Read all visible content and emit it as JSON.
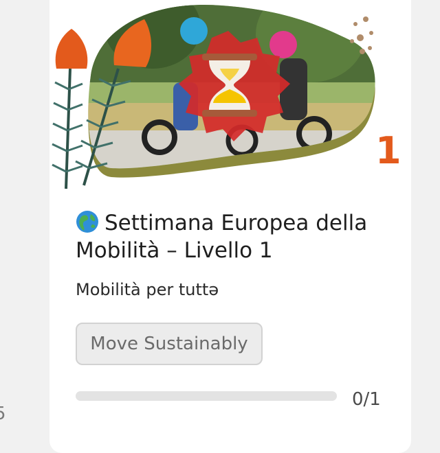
{
  "previous_card": {
    "count_fragment": "5"
  },
  "card": {
    "level_badge": "1",
    "title": "Settimana Europea della Mobilità – Livello 1",
    "title_icon": "globe-icon",
    "subtitle": "Mobilità per tuttə",
    "tag": "Move Sustainably",
    "progress": {
      "text": "0/1",
      "completed": 0,
      "total": 1
    },
    "status_icon": "hourglass-icon"
  },
  "colors": {
    "accent": "#e35a1c",
    "status_badge": "#d42a2a",
    "hourglass_sand": "#f5c400"
  }
}
